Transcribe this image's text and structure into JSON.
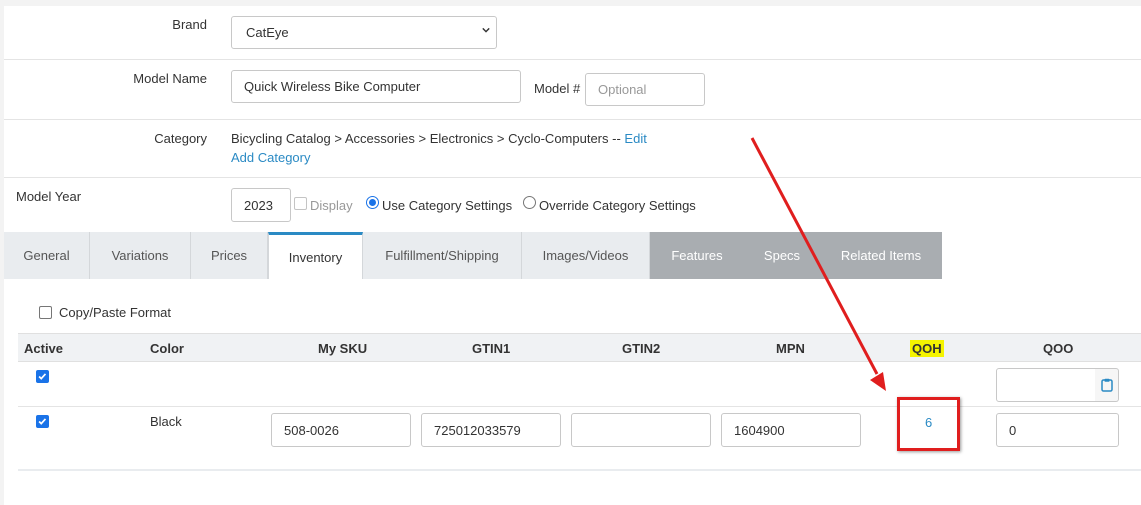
{
  "brand": {
    "label": "Brand",
    "selected": "CatEye"
  },
  "model": {
    "name_label": "Model Name",
    "name_value": "Quick Wireless Bike Computer",
    "number_label": "Model #",
    "number_placeholder": "Optional"
  },
  "category": {
    "label": "Category",
    "path": "Bicycling Catalog > Accessories > Electronics > Cyclo-Computers --",
    "edit_link": "Edit",
    "add_link": "Add Category"
  },
  "model_year": {
    "label": "Model Year",
    "value": "2023",
    "display_label": "Display",
    "use_category_label": "Use Category Settings",
    "override_label": "Override Category Settings"
  },
  "tabs": [
    {
      "label": "General"
    },
    {
      "label": "Variations"
    },
    {
      "label": "Prices"
    },
    {
      "label": "Inventory"
    },
    {
      "label": "Fulfillment/Shipping"
    },
    {
      "label": "Images/Videos"
    },
    {
      "label": "Features"
    },
    {
      "label": "Specs"
    },
    {
      "label": "Related Items"
    }
  ],
  "inventory": {
    "copy_paste_label": "Copy/Paste Format",
    "headers": {
      "active": "Active",
      "color": "Color",
      "my_sku": "My SKU",
      "gtin1": "GTIN1",
      "gtin2": "GTIN2",
      "mpn": "MPN",
      "qoh": "QOH",
      "qoo": "QOO"
    },
    "rows": [
      {
        "color": "Black",
        "my_sku": "508-0026",
        "gtin1": "725012033579",
        "gtin2": "",
        "mpn": "1604900",
        "qoh": "6",
        "qoo": "0"
      }
    ]
  },
  "colors": {
    "accent": "#2a8ac4",
    "annotation_red": "#e01e1e",
    "highlight_yellow": "#f5f400",
    "checkbox_blue": "#1a73e8"
  }
}
